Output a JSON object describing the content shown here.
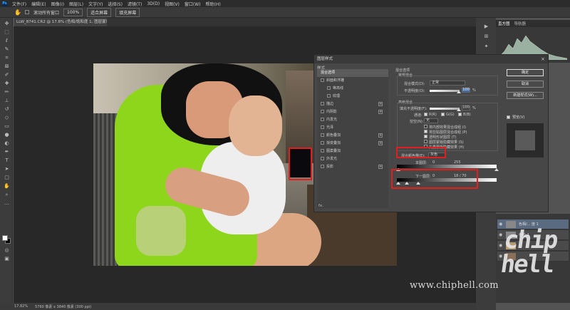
{
  "menu": {
    "app_logo": "Ps",
    "items": [
      "文件(F)",
      "编辑(E)",
      "图像(I)",
      "图层(L)",
      "文字(Y)",
      "选择(S)",
      "滤镜(T)",
      "3D(D)",
      "视图(V)",
      "窗口(W)",
      "帮助(H)"
    ]
  },
  "options": {
    "scroll_all_label": "滚动所有窗口",
    "zoom_value": "100%",
    "fit_screen_label": "适合屏幕",
    "fill_screen_label": "填充屏幕"
  },
  "document": {
    "tab_title": "LLW_8741.CR2 @ 17.8% (色相/饱和度 1, 图层蒙版/16) *"
  },
  "status": {
    "zoom": "17.82%",
    "doc_info": "5760 像素 x 3840 像素 (300 ppi)"
  },
  "right_panel": {
    "tabs": [
      "直方图",
      "导航器"
    ]
  },
  "layers": [
    {
      "name": "色相/... 度 1"
    },
    {
      "name": "色阶 1"
    },
    {
      "name": ""
    },
    {
      "name": ""
    }
  ],
  "dialog": {
    "title": "图层样式",
    "styles_header": "样式",
    "style_items": [
      {
        "label": "混合选项",
        "selected": true,
        "checkbox": false,
        "plus": false
      },
      {
        "label": "斜面和浮雕",
        "selected": false,
        "checkbox": true,
        "plus": false
      },
      {
        "label": "等高线",
        "selected": false,
        "checkbox": true,
        "plus": false
      },
      {
        "label": "纹理",
        "selected": false,
        "checkbox": true,
        "plus": false
      },
      {
        "label": "描边",
        "selected": false,
        "checkbox": true,
        "plus": true
      },
      {
        "label": "内阴影",
        "selected": false,
        "checkbox": true,
        "plus": true
      },
      {
        "label": "内发光",
        "selected": false,
        "checkbox": true,
        "plus": false
      },
      {
        "label": "光泽",
        "selected": false,
        "checkbox": true,
        "plus": false
      },
      {
        "label": "颜色叠加",
        "selected": false,
        "checkbox": true,
        "plus": true
      },
      {
        "label": "渐变叠加",
        "selected": false,
        "checkbox": true,
        "plus": true
      },
      {
        "label": "图案叠加",
        "selected": false,
        "checkbox": true,
        "plus": false
      },
      {
        "label": "外发光",
        "selected": false,
        "checkbox": true,
        "plus": false
      },
      {
        "label": "投影",
        "selected": false,
        "checkbox": true,
        "plus": true
      }
    ],
    "fx_label": "fx.",
    "blending_options_title": "混合选项",
    "general_blending_title": "常规混合",
    "blend_mode_label": "混合模式(D):",
    "blend_mode_value": "正常",
    "opacity_label": "不透明度(O):",
    "opacity_value": "100",
    "percent": "%",
    "advanced_blending_title": "高级混合",
    "fill_opacity_label": "填充不透明度(F):",
    "fill_opacity_value": "100",
    "channels_label": "通道:",
    "channel_r": "R(R)",
    "channel_g": "G(G)",
    "channel_b": "B(B)",
    "knockout_label": "挖空(N):",
    "knockout_value": "无",
    "adv_options": [
      {
        "label": "将内部效果混合成组 (I)",
        "checked": false
      },
      {
        "label": "将剪贴图层混合成组 (P)",
        "checked": true
      },
      {
        "label": "透明形状图层 (T)",
        "checked": true
      },
      {
        "label": "图层蒙版隐藏效果 (S)",
        "checked": false
      },
      {
        "label": "矢量蒙版隐藏效果 (H)",
        "checked": false
      }
    ],
    "blend_if_label": "混合颜色带(E):",
    "blend_if_value": "灰色",
    "this_layer_label": "本图层:",
    "this_layer_left": "0",
    "this_layer_right": "255",
    "underlying_label": "下一图层:",
    "underlying_left": "0",
    "underlying_mid": "18 / 70",
    "btn_ok": "确定",
    "btn_cancel": "取消",
    "btn_new_style": "新建样式(W)...",
    "preview_label": "预览(V)"
  },
  "watermark": "www.chiphell.com",
  "logo_text": "chip hell"
}
